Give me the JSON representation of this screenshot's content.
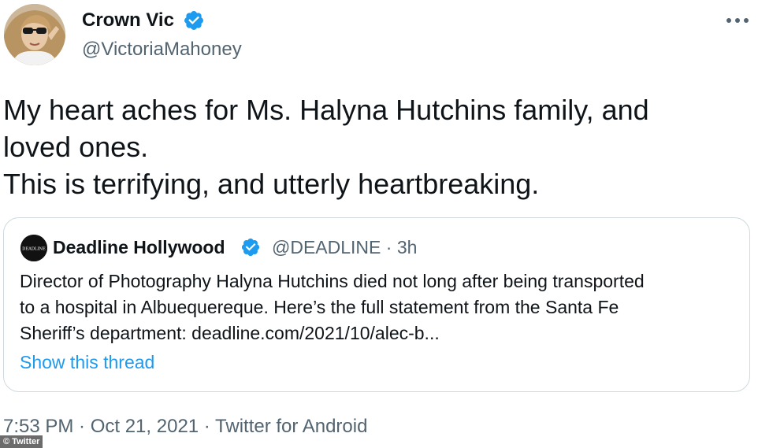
{
  "author": {
    "name": "Crown Vic",
    "handle": "@VictoriaMahoney",
    "verified": true
  },
  "tweet": {
    "lines": [
      "My heart aches for Ms. Halyna Hutchins family, and",
      "loved ones.",
      "This is terrifying, and utterly heartbreaking."
    ]
  },
  "quoted": {
    "name": "Deadline Hollywood",
    "avatar_text": "DEADLINE",
    "meta": "@DEADLINE · 3h",
    "lines": [
      "Director of Photography Halyna Hutchins died not long after being transported",
      "to a hospital in Albuequereque. Here’s the full statement from the Santa Fe",
      "Sheriff’s department: deadline.com/2021/10/alec-b..."
    ],
    "thread_link": "Show this thread"
  },
  "footer": {
    "timestamp": "7:53 PM · Oct 21, 2021 · Twitter for Android"
  },
  "credit": "© Twitter",
  "colors": {
    "verified": "#1d9bf0",
    "link": "#1d9bf0",
    "secondary_text": "#536471",
    "border": "#cfd9de"
  },
  "icons": [
    "verified-badge-icon",
    "more-options-icon"
  ]
}
